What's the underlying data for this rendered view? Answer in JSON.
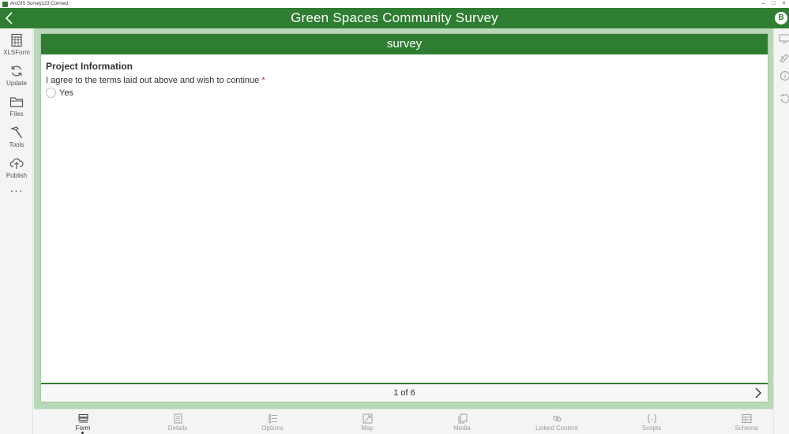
{
  "window": {
    "title": "ArcGIS Survey123 Connect",
    "controls": {
      "minimize": "–",
      "maximize": "□",
      "close": "×"
    }
  },
  "header": {
    "title": "Green Spaces Community Survey",
    "user_initial": "B"
  },
  "sidebar": {
    "items": [
      {
        "label": "XLSForm",
        "icon": "spreadsheet-icon"
      },
      {
        "label": "Update",
        "icon": "refresh-icon"
      },
      {
        "label": "Files",
        "icon": "folder-icon"
      },
      {
        "label": "Tools",
        "icon": "hammer-icon"
      },
      {
        "label": "Publish",
        "icon": "cloud-upload-icon"
      }
    ],
    "more": "···"
  },
  "form": {
    "title": "survey",
    "group_title": "Project Information",
    "question": {
      "label": "I agree to the terms laid out above and wish to continue",
      "required_marker": "*",
      "options": [
        {
          "label": "Yes",
          "selected": false
        }
      ]
    },
    "pager": "1 of 6"
  },
  "tabs": [
    {
      "label": "Form",
      "icon": "form-icon",
      "active": true
    },
    {
      "label": "Details",
      "icon": "details-icon",
      "active": false
    },
    {
      "label": "Options",
      "icon": "options-icon",
      "active": false
    },
    {
      "label": "Map",
      "icon": "map-icon",
      "active": false
    },
    {
      "label": "Media",
      "icon": "media-icon",
      "active": false
    },
    {
      "label": "Linked Content",
      "icon": "link-icon",
      "active": false
    },
    {
      "label": "Scripts",
      "icon": "scripts-icon",
      "active": false
    },
    {
      "label": "Schema",
      "icon": "schema-icon",
      "active": false
    }
  ],
  "colors": {
    "brand_green": "#2f7d32",
    "stage_green": "#b8d8b9",
    "required_red": "#c62828"
  }
}
